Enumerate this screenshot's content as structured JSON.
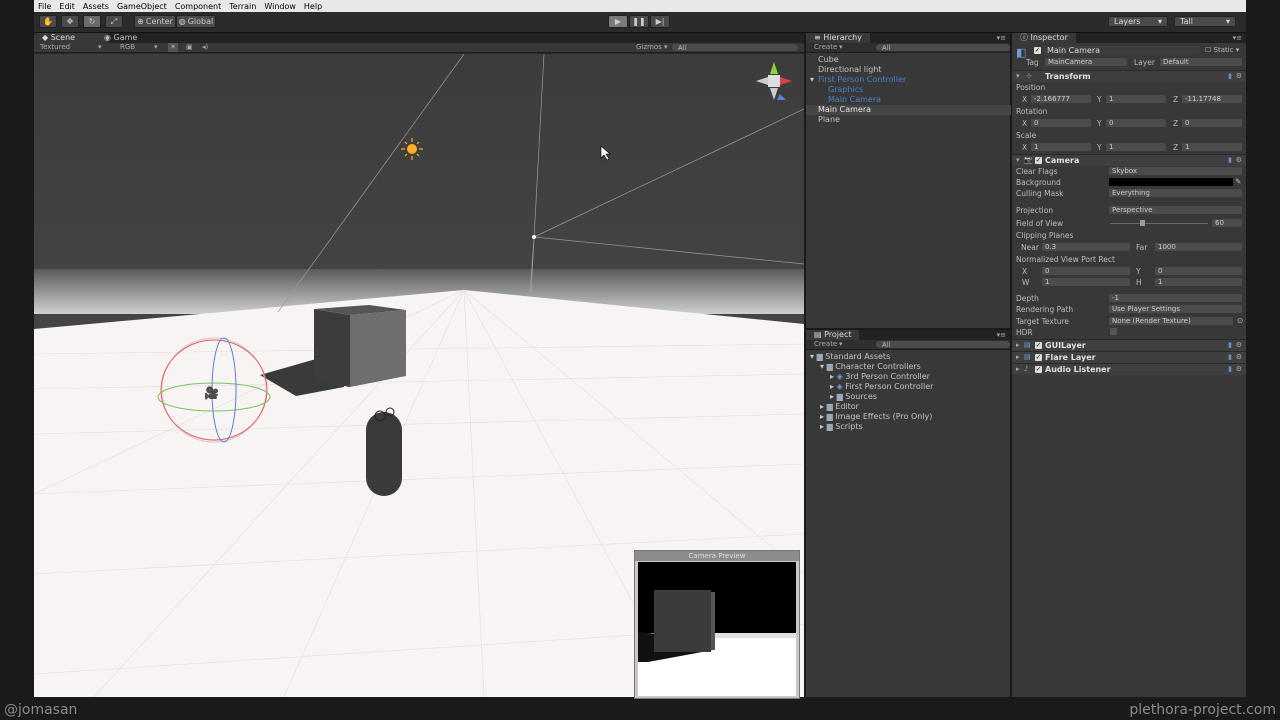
{
  "menu": [
    "File",
    "Edit",
    "Assets",
    "GameObject",
    "Component",
    "Terrain",
    "Window",
    "Help"
  ],
  "toolbar": {
    "pivot": "Center",
    "space": "Global",
    "layers": "Layers",
    "layout": "Tall"
  },
  "scene": {
    "tab_scene": "Scene",
    "tab_game": "Game",
    "render_mode": "Textured",
    "color_mode": "RGB",
    "gizmos": "Gizmos",
    "search": "All",
    "preview_title": "Camera Preview"
  },
  "hierarchy": {
    "title": "Hierarchy",
    "create": "Create",
    "search": "All",
    "items": [
      "Cube",
      "Directional light",
      "First Person Controller",
      "Graphics",
      "Main Camera",
      "Main Camera",
      "Plane"
    ]
  },
  "project": {
    "title": "Project",
    "create": "Create",
    "search": "All",
    "items": [
      "Standard Assets",
      "Character Controllers",
      "3rd Person Controller",
      "First Person Controller",
      "Sources",
      "Editor",
      "Image Effects (Pro Only)",
      "Scripts"
    ]
  },
  "inspector": {
    "title": "Inspector",
    "object_name": "Main Camera",
    "static": "Static",
    "tag_label": "Tag",
    "tag": "MainCamera",
    "layer_label": "Layer",
    "layer": "Default",
    "transform": {
      "title": "Transform",
      "position": "Position",
      "rotation": "Rotation",
      "scale": "Scale",
      "pos": [
        "-2.166777",
        "1",
        "-11.17748"
      ],
      "rot": [
        "0",
        "0",
        "0"
      ],
      "scl": [
        "1",
        "1",
        "1"
      ]
    },
    "axes": [
      "X",
      "Y",
      "Z"
    ],
    "camera": {
      "title": "Camera",
      "clear_flags_label": "Clear Flags",
      "clear_flags": "Skybox",
      "background_label": "Background",
      "culling_label": "Culling Mask",
      "culling": "Everything",
      "projection_label": "Projection",
      "projection": "Perspective",
      "fov_label": "Field of View",
      "fov": "60",
      "clipping_label": "Clipping Planes",
      "near_label": "Near",
      "near": "0.3",
      "far_label": "Far",
      "far": "1000",
      "viewport_label": "Normalized View Port Rect",
      "vx": "0",
      "vy": "0",
      "vw": "1",
      "vh": "1",
      "x": "X",
      "y": "Y",
      "w": "W",
      "h": "H",
      "depth_label": "Depth",
      "depth": "-1",
      "render_path_label": "Rendering Path",
      "render_path": "Use Player Settings",
      "target_label": "Target Texture",
      "target": "None (Render Texture)",
      "hdr_label": "HDR"
    },
    "components": [
      "GUILayer",
      "Flare Layer",
      "Audio Listener"
    ]
  },
  "watermark": {
    "left": "@jomasan",
    "right": "plethora-project.com"
  },
  "colors": {
    "accent_blue": "#4a7fd0",
    "panel": "#383838",
    "floor": "#f7f4f3",
    "sky": "#3e3e3e"
  }
}
